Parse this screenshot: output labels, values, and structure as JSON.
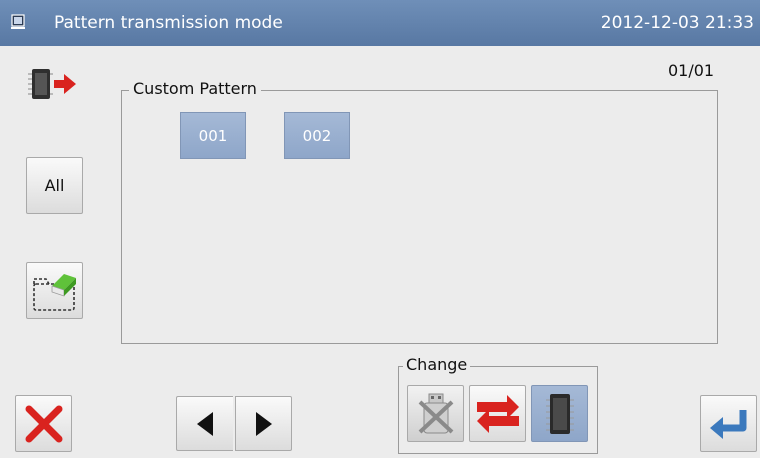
{
  "titlebar": {
    "title": "Pattern transmission mode",
    "datetime": "2012-12-03  21:33"
  },
  "toolbar": {
    "transfer_icon": "memory-transfer-icon",
    "all_label": "All",
    "folder_icon": "folder-icon"
  },
  "page_indicator": "01/01",
  "custom_pattern": {
    "label": "Custom Pattern",
    "patterns": [
      "001",
      "002"
    ]
  },
  "change": {
    "label": "Change",
    "options": [
      "usb-disabled-icon",
      "swap-arrows-icon",
      "memory-chip-icon"
    ]
  },
  "nav": {
    "close_icon": "close-icon",
    "prev_icon": "left-arrow-icon",
    "next_icon": "right-arrow-icon",
    "enter_icon": "enter-icon"
  },
  "colors": {
    "titlebar": "#6283ad",
    "selected": "#9db2d2",
    "close_red": "#d9231f",
    "enter_blue": "#3b79bd"
  }
}
